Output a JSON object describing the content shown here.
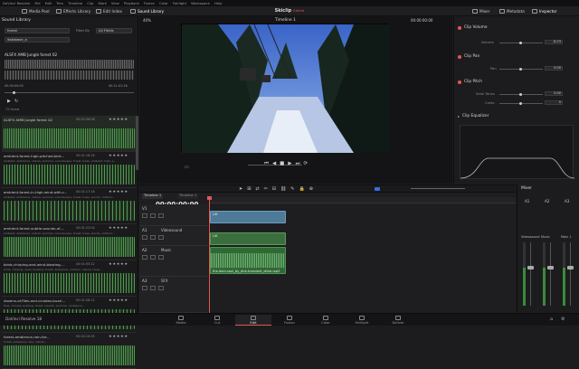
{
  "menu": [
    "DaVinci Resolve",
    "File",
    "Edit",
    "Trim",
    "Timeline",
    "Clip",
    "Mark",
    "View",
    "Playback",
    "Fusion",
    "Color",
    "Fairlight",
    "Workspace",
    "Help"
  ],
  "toolbar": {
    "media_pool": "Media Pool",
    "effects_library": "Effects Library",
    "edit_index": "Edit Index",
    "sound_library": "Sound Library",
    "project": "Skiclip",
    "edited": "Edited",
    "mixer": "Mixer",
    "metadata": "Metadata",
    "inspector": "Inspector"
  },
  "library": {
    "title": "Sound Library",
    "search_value": "forest",
    "filter_label": "Filter By",
    "filter_value": "All Fields",
    "db_value": "database_a",
    "preview_title": "ALSFX AMB Jungle forest 02",
    "preview_time_start": "00:00:00:00",
    "preview_time_end": "00:11:41:16",
    "results_count": "72 found",
    "results": [
      {
        "title": "ALSFX AMB Jungle forest 02",
        "dur": "00:02:36:08",
        "stars": "★★★★★",
        "tags": "",
        "selected": true
      },
      {
        "title": "ambient-forest-high-pitched-bird...",
        "dur": "00:01:16:18",
        "stars": "★★★★★",
        "tags": "ambient, ambience, nature, summer, soundscape, forest, trees, ambient, high, p..."
      },
      {
        "title": "ambient-forest-in-high-wind-with-c...",
        "dur": "00:01:17:16",
        "stars": "★★★★★",
        "tags": "ambient, ambience, nature, summer, soundscape, forest, trees, woods, outdoor..."
      },
      {
        "title": "ambient-forest-subtle-sounds-of-...",
        "dur": "00:01:22:04",
        "stars": "★★★★★",
        "tags": "ambient, ambience, nature, summer, soundscape, forest, trees, woods, outdoor..."
      },
      {
        "title": "birds-chirping-and-wind-blowing-...",
        "dur": "00:01:05:22",
        "stars": "★★★★★",
        "tags": "birds, chirping, wind, blowing, forest, ambience, outdoor, nature, trees..."
      },
      {
        "title": "dozens-of-flies-and-cicadas-buzzi...",
        "dur": "00:01:08:12",
        "stars": "★★★★★",
        "tags": "flies, cicadas, buzzing, forest, insects, summer, ambience..."
      },
      {
        "title": "forest-ambience-rain-for...",
        "dur": "00:02:10:05",
        "stars": "★★★★★",
        "tags": "forest, ambience, rain, nature..."
      }
    ]
  },
  "viewer": {
    "zoom": "40%",
    "timeline_name": "Timeline 1",
    "timecode": "00:00:00:00"
  },
  "inspector": {
    "sections": [
      {
        "name": "Clip Volume",
        "param": "Volume",
        "value": "-6.23"
      },
      {
        "name": "Clip Pan",
        "param": "Pan",
        "value": "0.00"
      },
      {
        "name": "Clip Pitch",
        "param": "Semi Tones",
        "value": "0.00",
        "param2": "Cents",
        "value2": "0"
      },
      {
        "name": "Clip Equalizer"
      }
    ]
  },
  "timeline": {
    "tabs": [
      "Timeline 1",
      "Timeline 1"
    ],
    "timecode": "00:00:00:00",
    "tracks": [
      {
        "id": "V1",
        "name": "",
        "buttons": [
          "",
          ""
        ]
      },
      {
        "id": "A1",
        "name": "Videosound",
        "value": "2.0"
      },
      {
        "id": "A2",
        "name": "Music",
        "value": "2.0"
      },
      {
        "id": "A3",
        "name": "SFX",
        "value": "2.0"
      }
    ],
    "clips": {
      "video": "Lift",
      "music": "Lift",
      "sfx": "the-dem-soul_by_dhe-transient_drive-mp3"
    }
  },
  "mixer": {
    "title": "Mixer",
    "channels": [
      "A1",
      "A2",
      "A3"
    ],
    "names": [
      "Videosound",
      "Music",
      "Main 1"
    ]
  },
  "pages": [
    "Media",
    "Cut",
    "Edit",
    "Fusion",
    "Color",
    "Fairlight",
    "Deliver"
  ],
  "active_page": "Edit",
  "app_name": "DaVinci Resolve 18",
  "colors": {
    "accent": "#e25850",
    "audio_green": "#3a7a3a",
    "video_blue": "#2f5f7d"
  }
}
